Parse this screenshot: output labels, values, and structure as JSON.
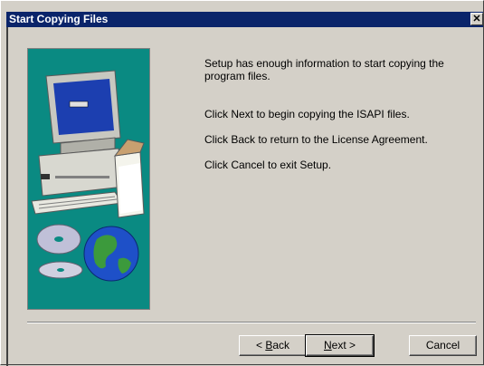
{
  "window": {
    "title": "Start Copying Files",
    "close_glyph": "✕"
  },
  "message": {
    "line1": "Setup has enough information to start copying the program files.",
    "line2": "Click Next to begin copying the ISAPI files.",
    "line3": "Click Back to return to the License Agreement.",
    "line4": "Click Cancel to exit Setup."
  },
  "buttons": {
    "back_prefix": "< ",
    "back_key": "B",
    "back_rest": "ack",
    "next_key": "N",
    "next_rest": "ext >",
    "cancel": "Cancel"
  },
  "colors": {
    "title_bar": "#0a246a",
    "panel_teal": "#0a8a82",
    "dialog_bg": "#d4d0c8"
  },
  "icons": [
    "computer-illustration",
    "cd-disc-icon",
    "globe-icon",
    "close-icon"
  ]
}
